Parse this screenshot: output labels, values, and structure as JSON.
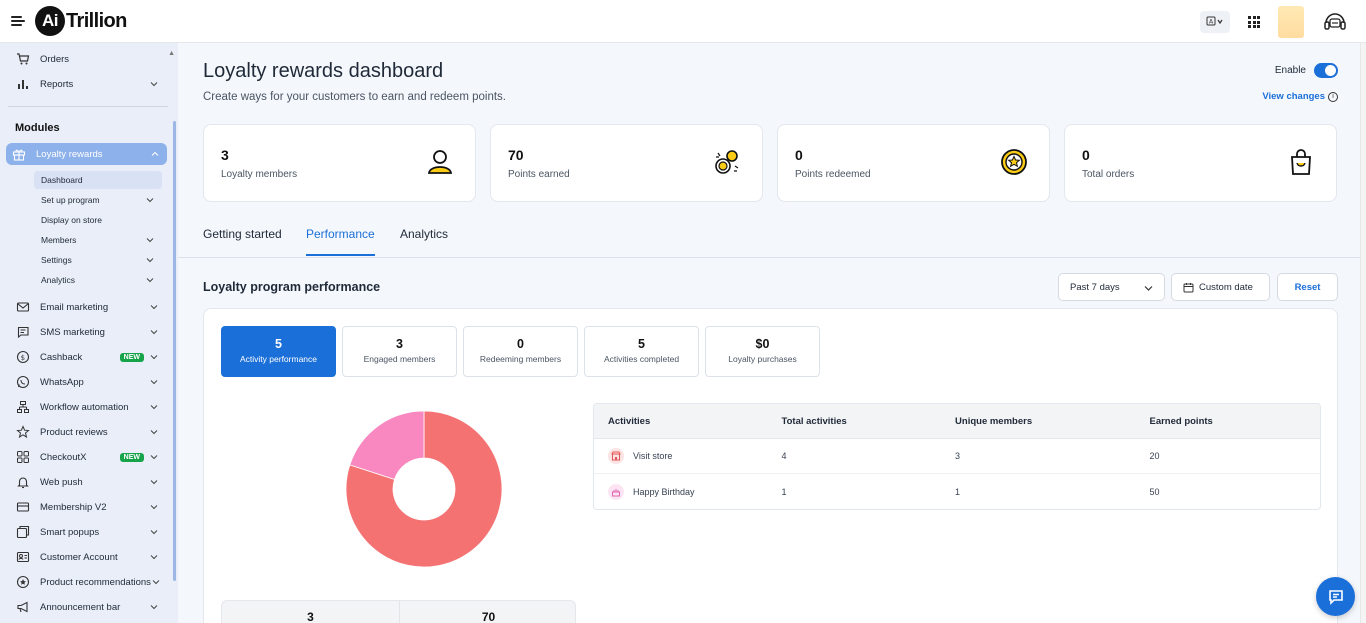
{
  "header": {
    "logo_mark": "Ai",
    "logo_text": "Trillion"
  },
  "sidebar": {
    "items_top": [
      {
        "label": "Orders"
      },
      {
        "label": "Reports"
      }
    ],
    "modules_label": "Modules",
    "active_module": "Loyalty rewards",
    "sub_items": [
      {
        "label": "Dashboard"
      },
      {
        "label": "Set up program"
      },
      {
        "label": "Display on store"
      },
      {
        "label": "Members"
      },
      {
        "label": "Settings"
      },
      {
        "label": "Analytics"
      }
    ],
    "modules": [
      {
        "label": "Email marketing"
      },
      {
        "label": "SMS marketing"
      },
      {
        "label": "Cashback",
        "badge": "NEW"
      },
      {
        "label": "WhatsApp"
      },
      {
        "label": "Workflow automation"
      },
      {
        "label": "Product reviews"
      },
      {
        "label": "CheckoutX",
        "badge": "NEW"
      },
      {
        "label": "Web push"
      },
      {
        "label": "Membership V2"
      },
      {
        "label": "Smart popups"
      },
      {
        "label": "Customer Account"
      },
      {
        "label": "Product recommendations"
      },
      {
        "label": "Announcement bar"
      }
    ]
  },
  "page": {
    "title": "Loyalty rewards dashboard",
    "subtitle": "Create ways for your customers to earn and redeem points.",
    "enable_label": "Enable",
    "enabled": true,
    "view_changes": "View changes"
  },
  "stats": [
    {
      "value": "3",
      "label": "Loyalty members",
      "icon": "user-icon"
    },
    {
      "value": "70",
      "label": "Points earned",
      "icon": "coins-icon"
    },
    {
      "value": "0",
      "label": "Points redeemed",
      "icon": "star-coin-icon"
    },
    {
      "value": "0",
      "label": "Total orders",
      "icon": "shopping-bag-icon"
    }
  ],
  "tabs": [
    {
      "label": "Getting started"
    },
    {
      "label": "Performance"
    },
    {
      "label": "Analytics"
    }
  ],
  "active_tab": "Performance",
  "performance": {
    "title": "Loyalty program performance",
    "range": "Past 7 days",
    "custom_date": "Custom date",
    "reset": "Reset",
    "metrics": [
      {
        "value": "5",
        "label": "Activity performance"
      },
      {
        "value": "3",
        "label": "Engaged members"
      },
      {
        "value": "0",
        "label": "Redeeming members"
      },
      {
        "value": "5",
        "label": "Activities completed"
      },
      {
        "value": "$0",
        "label": "Loyalty purchases"
      }
    ],
    "summary": {
      "left": "3",
      "right": "70"
    }
  },
  "chart_data": {
    "type": "pie",
    "categories": [
      "Visit store",
      "Happy Birthday"
    ],
    "values": [
      4,
      1
    ],
    "colors": [
      "#f47272",
      "#f987c0"
    ]
  },
  "table": {
    "headers": [
      "Activities",
      "Total activities",
      "Unique members",
      "Earned points"
    ],
    "rows": [
      {
        "activity": "Visit store",
        "total": "4",
        "unique": "3",
        "points": "20",
        "icon": "store-icon"
      },
      {
        "activity": "Happy Birthday",
        "total": "1",
        "unique": "1",
        "points": "50",
        "icon": "cake-icon"
      }
    ]
  },
  "colors": {
    "accent": "#1b6fd8",
    "sidebar_bg": "#e9eef8",
    "sidebar_active": "#8db1ea",
    "badge_new": "#16a34a"
  }
}
